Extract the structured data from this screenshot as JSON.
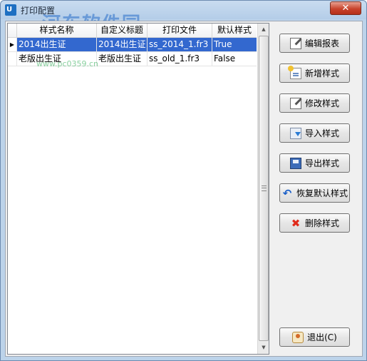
{
  "window": {
    "icon_text": "U",
    "title": "打印配置",
    "close_label": "✕",
    "watermark": "河东软件园",
    "watermark_sub": "www.pc0359.cn"
  },
  "grid": {
    "columns": [
      "样式名称",
      "自定义标题",
      "打印文件",
      "默认样式"
    ],
    "rows": [
      {
        "name": "2014出生证",
        "title": "2014出生证",
        "file": "ss_2014_1.fr3",
        "default": "True",
        "selected": true
      },
      {
        "name": "老版出生证",
        "title": "老版出生证",
        "file": "ss_old_1.fr3",
        "default": "False",
        "selected": false
      }
    ],
    "current_row_marker": "▶"
  },
  "scrollbar": {
    "up_arrow": "▲",
    "down_arrow": "▼"
  },
  "buttons": {
    "edit_report": "编辑报表",
    "add_style": "新增样式",
    "modify_style": "修改样式",
    "import_style": "导入样式",
    "export_style": "导出样式",
    "restore_default": "恢复默认样式",
    "delete_style": "删除样式",
    "exit": "退出(C)"
  },
  "icons": {
    "restore_glyph": "↶",
    "delete_glyph": "✖"
  },
  "colors": {
    "selection": "#3368cf",
    "titlebar": "#bcd3ea",
    "close": "#c8432c"
  }
}
